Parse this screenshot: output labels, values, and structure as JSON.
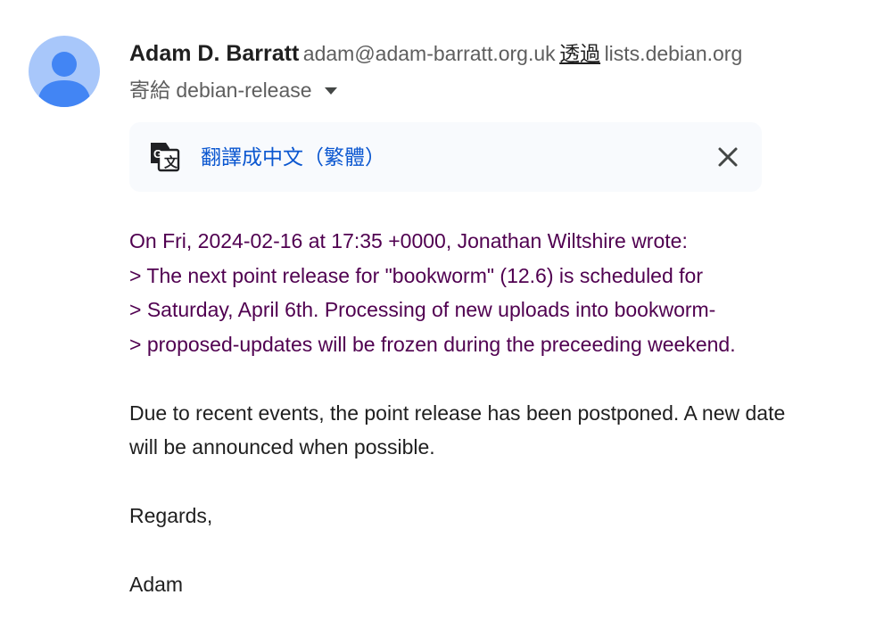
{
  "sender": {
    "avatar_icon": "person-avatar-icon",
    "name": "Adam D. Barratt",
    "email": "adam@adam-barratt.org.uk",
    "via_label": "透過",
    "via_domain": "lists.debian.org"
  },
  "recipient": {
    "label": "寄給 debian-release",
    "toggle_icon": "caret-down-icon"
  },
  "translate_bar": {
    "icon": "google-translate-icon",
    "link_text": "翻譯成中文（繁體）",
    "close_icon": "close-icon"
  },
  "message": {
    "quote_header": "On Fri, 2024-02-16 at 17:35 +0000, Jonathan Wiltshire wrote:",
    "quote_lines": [
      "> The next point release for \"bookworm\" (12.6) is scheduled for",
      "> Saturday, April 6th. Processing of new uploads into bookworm-",
      "> proposed-updates will be frozen during the preceeding weekend."
    ],
    "body_lines": [
      "Due to recent events, the point release has been postponed. A new date",
      "will be announced when possible."
    ],
    "closing": "Regards,",
    "signature": "Adam"
  },
  "colors": {
    "avatar_bg": "#a8c7fa",
    "avatar_fg": "#4285f4",
    "quote_text": "#500050",
    "link": "#0b57d0",
    "translate_bar_bg": "#f8fafd"
  }
}
